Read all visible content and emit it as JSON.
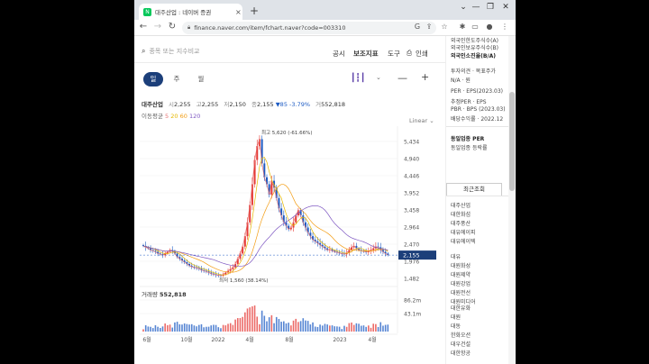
{
  "browser": {
    "tab_title": "대주산업 : 네이버 증권",
    "tab_close": "×",
    "new_tab": "+",
    "url": "finance.naver.com/item/fchart.naver?code=003310",
    "controls": {
      "minimize": "—",
      "restore": "❐",
      "close": "✕"
    },
    "nav": {
      "back": "←",
      "forward": "→",
      "reload": "↻"
    }
  },
  "topbar": {
    "search_placeholder": "종목 또는 지수비교",
    "menu": [
      "공시",
      "보조지표",
      "도구",
      "인쇄"
    ]
  },
  "periods": [
    "일",
    "주",
    "월"
  ],
  "active_period": "일",
  "quote": {
    "name": "대주산업",
    "open_label": "시",
    "open": "2,255",
    "high_label": "고",
    "high": "2,255",
    "low_label": "저",
    "low": "2,150",
    "close_label": "종",
    "close": "2,155",
    "change": "▼85 -3.79%",
    "vol_label": "거",
    "volume": "552,818"
  },
  "ma_legend": {
    "label": "이동평균",
    "items": [
      "5",
      "20",
      "60",
      "120"
    ]
  },
  "scale_mode": "Linear",
  "volume_label": {
    "label": "거래량",
    "value": "552,818"
  },
  "colors": {
    "up": "#e53935",
    "down": "#1e5cc4",
    "accent": "#1c3f7a",
    "ma5": "#e57373",
    "ma20": "#e6b800",
    "ma60": "#f39c12",
    "ma120": "#7e57c2"
  },
  "chart_data": {
    "type": "candlestick",
    "y_ticks": [
      "5,434",
      "4,940",
      "4,446",
      "3,952",
      "3,458",
      "2,964",
      "2,470",
      "1,976",
      "1,482"
    ],
    "y_range": [
      1482,
      5434
    ],
    "x_ticks": [
      "6월",
      "10월",
      "2022",
      "4월",
      "8월",
      "2023",
      "4월"
    ],
    "current_price": "2,155",
    "high_annotation": "최고 5,620 (-61.66%)",
    "low_annotation": "최저 1,560 (38.14%)",
    "volume_ticks": [
      "86.2m",
      "43.1m"
    ],
    "volume_max": 86200000,
    "series": [
      {
        "name": "종가",
        "values": [
          2420,
          2380,
          2350,
          2300,
          2280,
          2250,
          2200,
          2180,
          2150,
          2200,
          2250,
          2300,
          2280,
          2200,
          2100,
          2050,
          2000,
          1950,
          1900,
          1850,
          1820,
          1800,
          1780,
          1760,
          1720,
          1700,
          1680,
          1650,
          1620,
          1600,
          1580,
          1570,
          1560,
          1600,
          1650,
          1700,
          1750,
          1800,
          1900,
          2050,
          2200,
          2400,
          2700,
          3100,
          3600,
          4200,
          4900,
          5300,
          5500,
          4800,
          4400,
          4200,
          3900,
          4300,
          4100,
          3800,
          3500,
          3300,
          3100,
          3000,
          2900,
          2950,
          3100,
          3300,
          3450,
          3300,
          3100,
          2950,
          2800,
          2700,
          2600,
          2550,
          2500,
          2450,
          2400,
          2350,
          2300,
          2320,
          2280,
          2250,
          2230,
          2210,
          2200,
          2180,
          2220,
          2300,
          2380,
          2420,
          2350,
          2300,
          2280,
          2260,
          2240,
          2270,
          2300,
          2350,
          2400,
          2380,
          2300,
          2250,
          2200,
          2155
        ]
      }
    ]
  },
  "right_panel": {
    "lines_top": [
      "외국인한도주식수(A)",
      "외국인보유주식수(B)",
      "외국인소진율(B/A)",
      "투자의견 · 목표주가",
      "N/A · 원",
      "PER · EPS(2023.03)",
      "추정PER · EPS",
      "PBR · BPS (2023.03)",
      "배당수익률 · 2022.12",
      "동일업종 PER",
      "동일업종 등락률"
    ],
    "recent_tab": "최근조회",
    "recent": [
      "대주산업",
      "대한화섬",
      "대주풍산",
      "대유에이피",
      "대유에이텍"
    ],
    "group2": [
      "대유",
      "대원화성",
      "대원제약",
      "대원강업",
      "대원전선",
      "대원미디어"
    ],
    "group3": [
      "대한유화",
      "대원",
      "대동",
      "한화오션",
      "대우건설",
      "대한항공"
    ]
  }
}
